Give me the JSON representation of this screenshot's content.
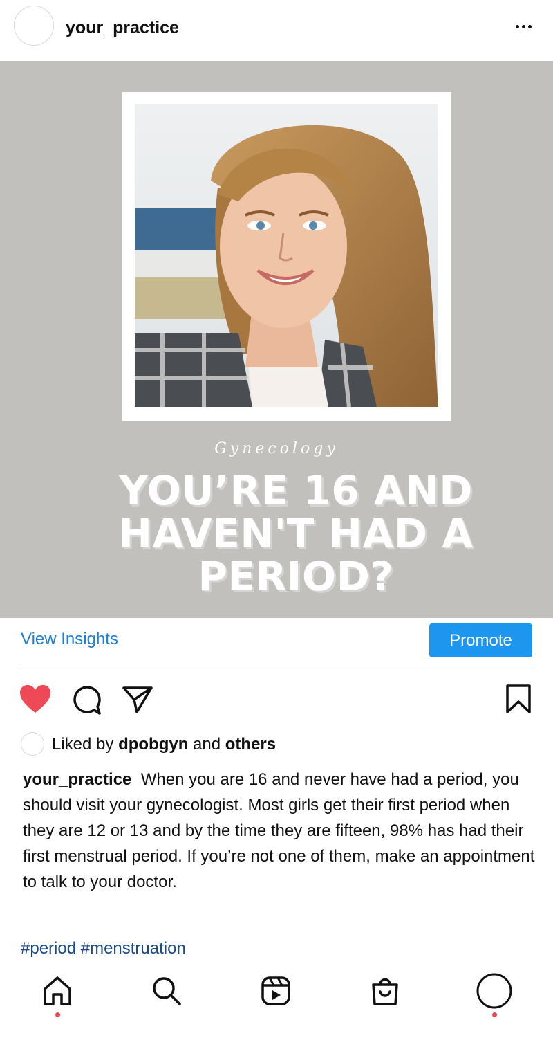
{
  "header": {
    "username": "your_practice"
  },
  "post": {
    "background": "#c1c0bc",
    "kicker": "Gynecology",
    "headline": "YOU’RE 16 AND HAVEN'T HAD A PERIOD?"
  },
  "insights": {
    "view_insights_label": "View Insights",
    "promote_label": "Promote",
    "accent": "#1d96f0"
  },
  "actions": {
    "liked": true,
    "like_color": "#ed4956",
    "icons": [
      "heart-icon",
      "comment-icon",
      "share-icon",
      "bookmark-icon"
    ]
  },
  "likes": {
    "prefix": "Liked by",
    "user": "dpobgyn",
    "middle": "and",
    "others": "others"
  },
  "caption": {
    "username": "your_practice",
    "text": "When you are 16 and never have had a period, you should visit your gynecologist. Most girls get their first period when they are 12 or 13 and by the time they are fifteen, 98% has had their first menstrual period. If you’re not one of them, make an appointment to talk to your doctor.",
    "hashtags": "#period #menstruation"
  },
  "nav": {
    "items": [
      "home-icon",
      "search-icon",
      "reels-icon",
      "shop-icon",
      "profile-icon"
    ],
    "notification_dot_color": "#ed4956"
  }
}
